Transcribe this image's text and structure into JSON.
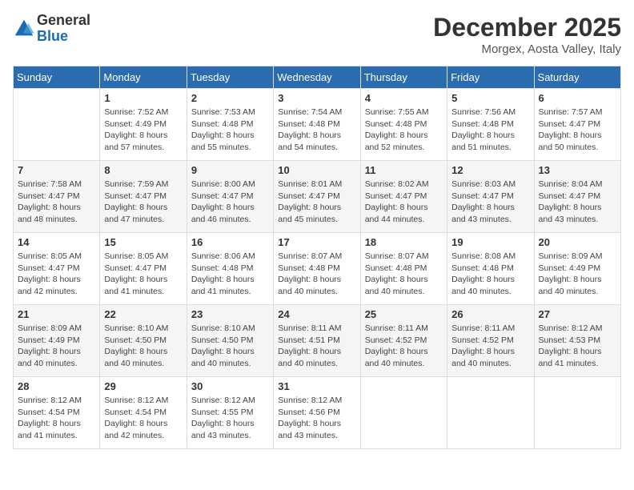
{
  "logo": {
    "general": "General",
    "blue": "Blue"
  },
  "title": "December 2025",
  "location": "Morgex, Aosta Valley, Italy",
  "days_of_week": [
    "Sunday",
    "Monday",
    "Tuesday",
    "Wednesday",
    "Thursday",
    "Friday",
    "Saturday"
  ],
  "weeks": [
    [
      {
        "day": "",
        "content": ""
      },
      {
        "day": "1",
        "content": "Sunrise: 7:52 AM\nSunset: 4:49 PM\nDaylight: 8 hours\nand 57 minutes."
      },
      {
        "day": "2",
        "content": "Sunrise: 7:53 AM\nSunset: 4:48 PM\nDaylight: 8 hours\nand 55 minutes."
      },
      {
        "day": "3",
        "content": "Sunrise: 7:54 AM\nSunset: 4:48 PM\nDaylight: 8 hours\nand 54 minutes."
      },
      {
        "day": "4",
        "content": "Sunrise: 7:55 AM\nSunset: 4:48 PM\nDaylight: 8 hours\nand 52 minutes."
      },
      {
        "day": "5",
        "content": "Sunrise: 7:56 AM\nSunset: 4:48 PM\nDaylight: 8 hours\nand 51 minutes."
      },
      {
        "day": "6",
        "content": "Sunrise: 7:57 AM\nSunset: 4:47 PM\nDaylight: 8 hours\nand 50 minutes."
      }
    ],
    [
      {
        "day": "7",
        "content": "Sunrise: 7:58 AM\nSunset: 4:47 PM\nDaylight: 8 hours\nand 48 minutes."
      },
      {
        "day": "8",
        "content": "Sunrise: 7:59 AM\nSunset: 4:47 PM\nDaylight: 8 hours\nand 47 minutes."
      },
      {
        "day": "9",
        "content": "Sunrise: 8:00 AM\nSunset: 4:47 PM\nDaylight: 8 hours\nand 46 minutes."
      },
      {
        "day": "10",
        "content": "Sunrise: 8:01 AM\nSunset: 4:47 PM\nDaylight: 8 hours\nand 45 minutes."
      },
      {
        "day": "11",
        "content": "Sunrise: 8:02 AM\nSunset: 4:47 PM\nDaylight: 8 hours\nand 44 minutes."
      },
      {
        "day": "12",
        "content": "Sunrise: 8:03 AM\nSunset: 4:47 PM\nDaylight: 8 hours\nand 43 minutes."
      },
      {
        "day": "13",
        "content": "Sunrise: 8:04 AM\nSunset: 4:47 PM\nDaylight: 8 hours\nand 43 minutes."
      }
    ],
    [
      {
        "day": "14",
        "content": "Sunrise: 8:05 AM\nSunset: 4:47 PM\nDaylight: 8 hours\nand 42 minutes."
      },
      {
        "day": "15",
        "content": "Sunrise: 8:05 AM\nSunset: 4:47 PM\nDaylight: 8 hours\nand 41 minutes."
      },
      {
        "day": "16",
        "content": "Sunrise: 8:06 AM\nSunset: 4:48 PM\nDaylight: 8 hours\nand 41 minutes."
      },
      {
        "day": "17",
        "content": "Sunrise: 8:07 AM\nSunset: 4:48 PM\nDaylight: 8 hours\nand 40 minutes."
      },
      {
        "day": "18",
        "content": "Sunrise: 8:07 AM\nSunset: 4:48 PM\nDaylight: 8 hours\nand 40 minutes."
      },
      {
        "day": "19",
        "content": "Sunrise: 8:08 AM\nSunset: 4:48 PM\nDaylight: 8 hours\nand 40 minutes."
      },
      {
        "day": "20",
        "content": "Sunrise: 8:09 AM\nSunset: 4:49 PM\nDaylight: 8 hours\nand 40 minutes."
      }
    ],
    [
      {
        "day": "21",
        "content": "Sunrise: 8:09 AM\nSunset: 4:49 PM\nDaylight: 8 hours\nand 40 minutes."
      },
      {
        "day": "22",
        "content": "Sunrise: 8:10 AM\nSunset: 4:50 PM\nDaylight: 8 hours\nand 40 minutes."
      },
      {
        "day": "23",
        "content": "Sunrise: 8:10 AM\nSunset: 4:50 PM\nDaylight: 8 hours\nand 40 minutes."
      },
      {
        "day": "24",
        "content": "Sunrise: 8:11 AM\nSunset: 4:51 PM\nDaylight: 8 hours\nand 40 minutes."
      },
      {
        "day": "25",
        "content": "Sunrise: 8:11 AM\nSunset: 4:52 PM\nDaylight: 8 hours\nand 40 minutes."
      },
      {
        "day": "26",
        "content": "Sunrise: 8:11 AM\nSunset: 4:52 PM\nDaylight: 8 hours\nand 40 minutes."
      },
      {
        "day": "27",
        "content": "Sunrise: 8:12 AM\nSunset: 4:53 PM\nDaylight: 8 hours\nand 41 minutes."
      }
    ],
    [
      {
        "day": "28",
        "content": "Sunrise: 8:12 AM\nSunset: 4:54 PM\nDaylight: 8 hours\nand 41 minutes."
      },
      {
        "day": "29",
        "content": "Sunrise: 8:12 AM\nSunset: 4:54 PM\nDaylight: 8 hours\nand 42 minutes."
      },
      {
        "day": "30",
        "content": "Sunrise: 8:12 AM\nSunset: 4:55 PM\nDaylight: 8 hours\nand 43 minutes."
      },
      {
        "day": "31",
        "content": "Sunrise: 8:12 AM\nSunset: 4:56 PM\nDaylight: 8 hours\nand 43 minutes."
      },
      {
        "day": "",
        "content": ""
      },
      {
        "day": "",
        "content": ""
      },
      {
        "day": "",
        "content": ""
      }
    ]
  ]
}
